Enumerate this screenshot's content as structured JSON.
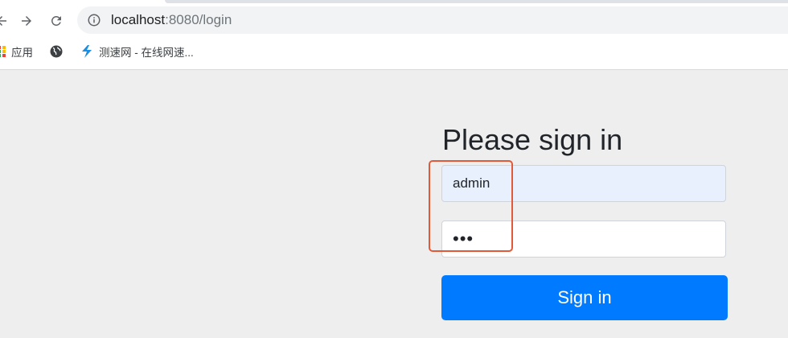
{
  "browser": {
    "url_host": "localhost",
    "url_path": ":8080/login",
    "bookmarks": [
      {
        "label": "应用",
        "icon": "apps-grid-icon"
      },
      {
        "label": "",
        "icon": "globe-icon"
      },
      {
        "label": "测速网 - 在线网速...",
        "icon": "speedtest-logo-icon"
      }
    ]
  },
  "login": {
    "title": "Please sign in",
    "username_value": "admin",
    "password_value": "•••",
    "submit_label": "Sign in"
  },
  "colors": {
    "primary": "#007bff",
    "autofill_bg": "#e8f0fe",
    "annotation": "#e05a3a",
    "page_bg": "#eeeeee"
  }
}
